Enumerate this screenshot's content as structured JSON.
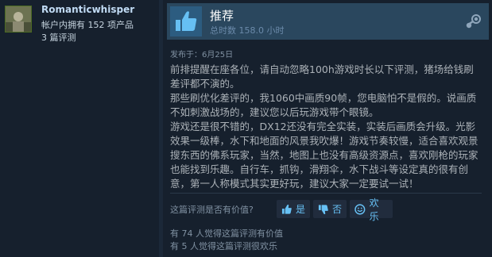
{
  "author": {
    "username": "Romanticwhisper",
    "products_owned": "帐户内拥有 152 项产品",
    "review_count": "3 篇评测"
  },
  "review": {
    "recommendation": "推荐",
    "hours": "总时数 158.0 小时",
    "posted": "发布于：6月25日",
    "paragraphs": [
      "前排提醒在座各位，请自动忽略100h游戏时长以下评测，猪场给钱刷差评都不演的。",
      "那些刷优化差评的，我1060中画质90帧，您电脑怕不是假的。说画质不如刺激战场的，建议您以后玩游戏带个眼镜。",
      "游戏还是很不错的，DX12还没有完全实装，实装后画质会升级。光影效果一级棒，水下和地面的风景我吹爆！游戏节奏较慢，适合喜欢观景搜东西的佛系玩家，当然，地图上也没有高级资源点，喜欢刚枪的玩家也能找到乐趣。自行车，抓钩，滑翔伞，水下战斗等设定真的很有创意，第一人称模式其实更好玩，建议大家一定要试一试！"
    ]
  },
  "feedback": {
    "question": "这篇评测是否有价值?",
    "yes_label": "是",
    "no_label": "否",
    "funny_label": "欢乐",
    "helpful_count": "有 74 人觉得这篇评测有价值",
    "funny_count": "有 5 人觉得这篇评测很欢乐"
  },
  "icons": {
    "recommend": "thumbs-up-icon",
    "platform": "steam-icon",
    "yes": "thumbs-up-icon",
    "no": "thumbs-down-icon",
    "funny": "smiley-icon"
  },
  "colors": {
    "background": "#1b2838",
    "header": "#2a475e",
    "link": "#67c1f5",
    "username": "#c1dbf4"
  }
}
